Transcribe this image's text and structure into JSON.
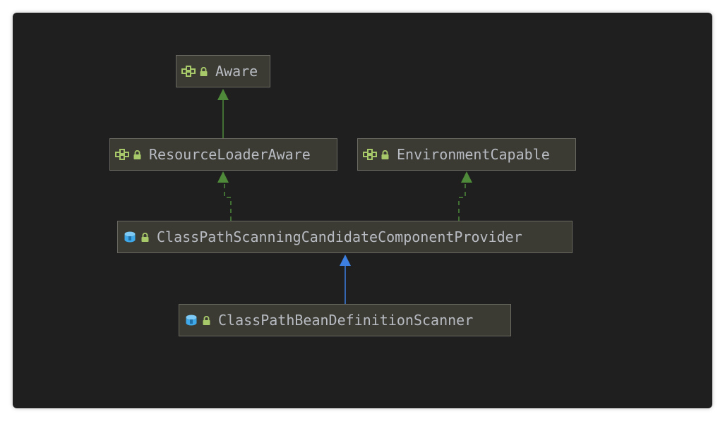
{
  "colors": {
    "background": "#1f1f1f",
    "node_fill": "#3b3b34",
    "node_border": "#6a6a62",
    "text": "#b8bcc2",
    "interface_icon": "#a8c96a",
    "class_icon": "#3ea8e8",
    "lock_icon": "#a8c96a",
    "implements_edge": "#4f8a3a",
    "extends_edge": "#3d7fe0"
  },
  "nodes": {
    "aware": {
      "label": "Aware",
      "kind_icon": "interface-icon"
    },
    "resource_loader_aware": {
      "label": "ResourceLoaderAware",
      "kind_icon": "interface-icon"
    },
    "environment_capable": {
      "label": "EnvironmentCapable",
      "kind_icon": "interface-icon"
    },
    "provider": {
      "label": "ClassPathScanningCandidateComponentProvider",
      "kind_icon": "class-icon"
    },
    "scanner": {
      "label": "ClassPathBeanDefinitionScanner",
      "kind_icon": "class-icon"
    }
  },
  "edges": [
    {
      "from": "ResourceLoaderAware",
      "to": "Aware",
      "relation": "extends interface",
      "style": "solid"
    },
    {
      "from": "ClassPathScanningCandidateComponentProvider",
      "to": "ResourceLoaderAware",
      "relation": "implements",
      "style": "dashed"
    },
    {
      "from": "ClassPathScanningCandidateComponentProvider",
      "to": "EnvironmentCapable",
      "relation": "implements",
      "style": "dashed"
    },
    {
      "from": "ClassPathBeanDefinitionScanner",
      "to": "ClassPathScanningCandidateComponentProvider",
      "relation": "extends",
      "style": "solid"
    }
  ]
}
